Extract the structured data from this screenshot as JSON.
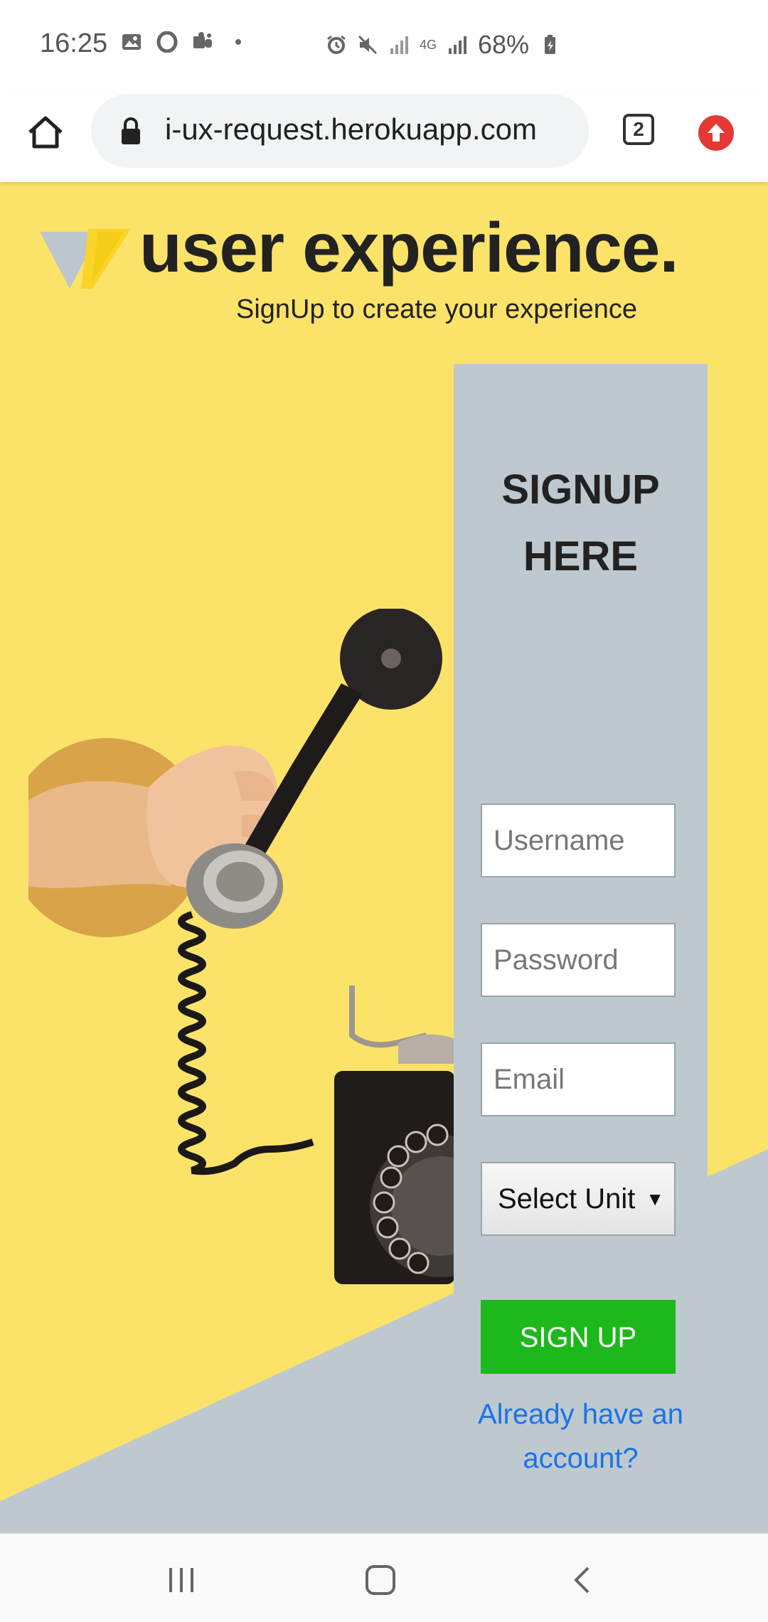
{
  "status_bar": {
    "time": "16:25",
    "network": "4G",
    "battery": "68%",
    "icons": [
      "gallery-icon",
      "opera-icon",
      "teams-icon",
      "dot-icon",
      "alarm-icon",
      "mute-icon",
      "signal-icon",
      "signal-icon",
      "battery-icon"
    ]
  },
  "browser": {
    "url": "i-ux-request.herokuapp.com",
    "tab_count": "2"
  },
  "page": {
    "headline": "user experience.",
    "subheadline": "SignUp to create your experience",
    "form": {
      "title_line1": "SIGNUP",
      "title_line2": "HERE",
      "username_placeholder": "Username",
      "password_placeholder": "Password",
      "email_placeholder": "Email",
      "unit_select": "Select Unit",
      "submit_label": "SIGN UP",
      "login_link_line1": "Already have an",
      "login_link_line2": "account?"
    }
  },
  "colors": {
    "page_background": "#fbe36a",
    "panel": "#bec9cf",
    "signup_button": "#1db81b",
    "link": "#1a73e8"
  }
}
